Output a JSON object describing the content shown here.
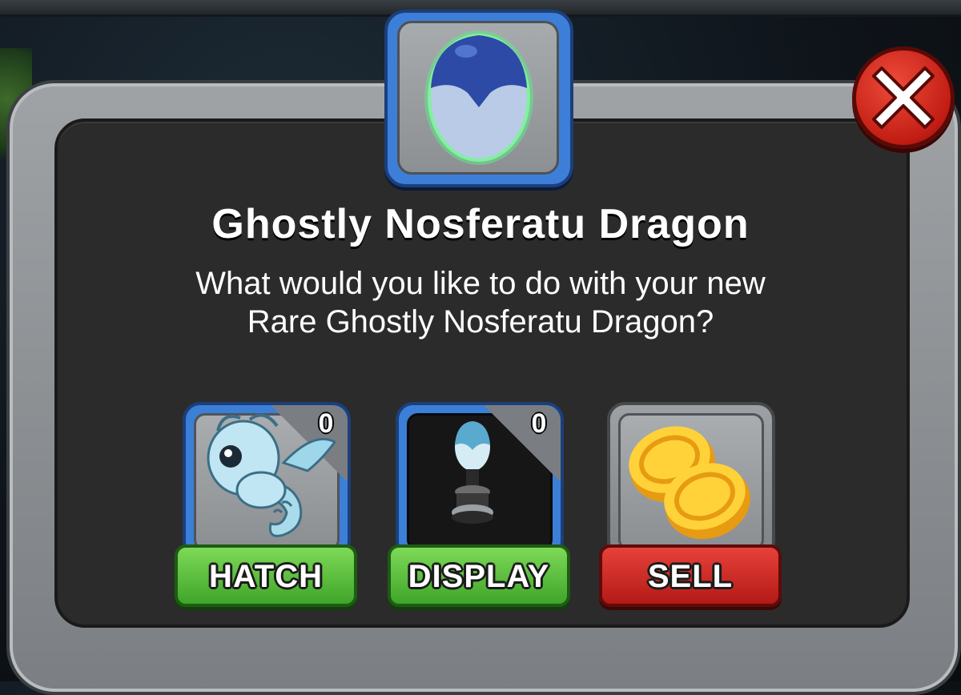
{
  "dialog": {
    "title": "Ghostly Nosferatu Dragon",
    "prompt_line1": "What would you like to do with your new",
    "prompt_line2": "Rare Ghostly Nosferatu Dragon?"
  },
  "options": [
    {
      "id": "hatch",
      "label": "HATCH",
      "count": "0",
      "icon": "ghost-dragon-icon"
    },
    {
      "id": "display",
      "label": "DISPLAY",
      "count": "0",
      "icon": "egg-pedestal-icon"
    },
    {
      "id": "sell",
      "label": "SELL",
      "icon": "gold-coins-icon"
    }
  ],
  "colors": {
    "accent_blue": "#3d7fd8",
    "green_button": "#3fa52a",
    "red_button": "#b41a16",
    "close_red": "#c21d14"
  }
}
